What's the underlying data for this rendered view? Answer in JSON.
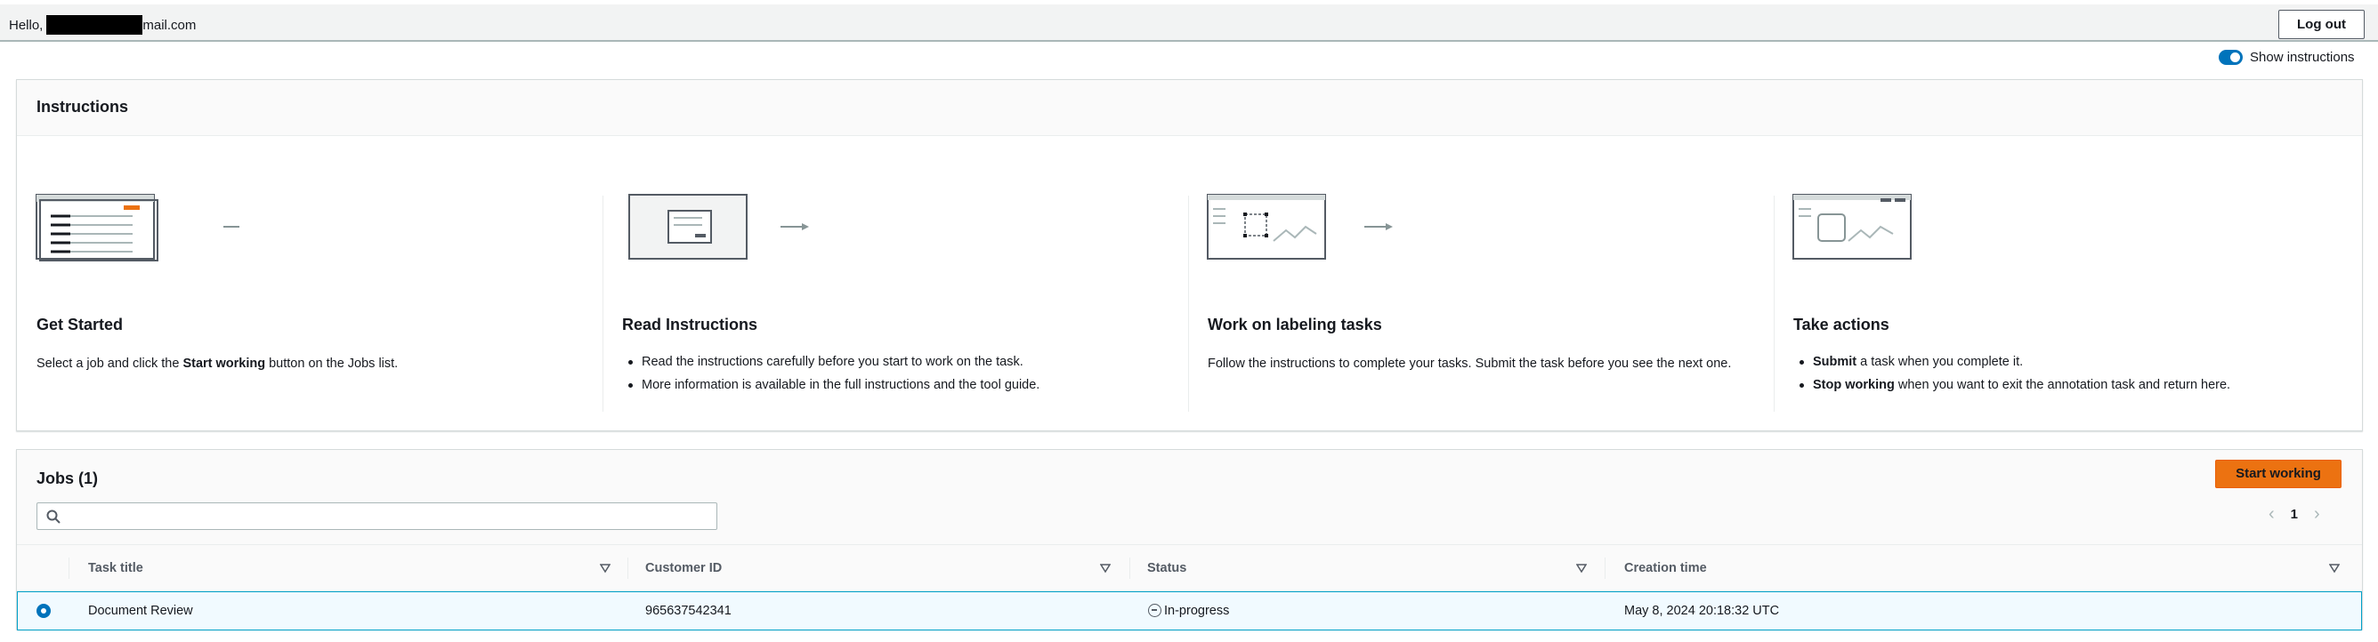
{
  "header": {
    "hello_prefix": "Hello,",
    "email_suffix": "mail.com",
    "logout_label": "Log out"
  },
  "toggle": {
    "label": "Show instructions",
    "on": true
  },
  "instructions": {
    "title": "Instructions",
    "steps": [
      {
        "title": "Get Started",
        "text_parts": [
          "Select a job and click the ",
          "Start working",
          " button on the Jobs list."
        ]
      },
      {
        "title": "Read Instructions",
        "bullets": [
          "Read the instructions carefully before you start to work on the task.",
          "More information is available in the full instructions and the tool guide."
        ]
      },
      {
        "title": "Work on labeling tasks",
        "text": "Follow the instructions to complete your tasks. Submit the task before you see the next one."
      },
      {
        "title": "Take actions",
        "bullets": [
          {
            "strong": "Submit",
            "rest": " a task when you complete it."
          },
          {
            "strong": "Stop working",
            "rest": " when you want to exit the annotation task and return here."
          }
        ]
      }
    ]
  },
  "jobs": {
    "title": "Jobs (1)",
    "start_label": "Start working",
    "search_placeholder": "",
    "page": "1",
    "columns": [
      "Task title",
      "Customer ID",
      "Status",
      "Creation time"
    ],
    "rows": [
      {
        "selected": true,
        "task_title": "Document Review",
        "customer_id": "965637542341",
        "status": "In-progress",
        "creation_time": "May 8, 2024 20:18:32 UTC"
      }
    ]
  },
  "colors": {
    "accent": "#0073bb",
    "primary_button": "#ec7211",
    "selected_row_bg": "#f1faff",
    "selected_row_border": "#00a1c9"
  }
}
